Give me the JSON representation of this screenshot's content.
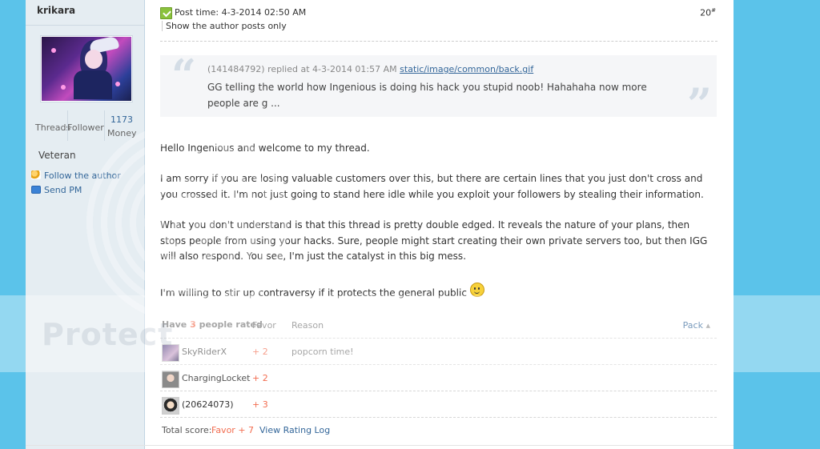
{
  "author": {
    "name": "krikara",
    "stats": [
      {
        "label": "Threads",
        "value": ""
      },
      {
        "label": "Follower",
        "value": ""
      },
      {
        "label": "Money",
        "value": "1173"
      }
    ],
    "rank": "Veteran",
    "follow_label": "Follow the author",
    "pm_label": "Send PM"
  },
  "post": {
    "time": "Post time: 4-3-2014 02:50 AM",
    "floor": "20",
    "floor_suffix": "#",
    "author_only": "Show the author posts only",
    "quote": {
      "meta": "(141484792) replied at 4-3-2014 01:57 AM",
      "link": "static/image/common/back.gif",
      "text": "GG telling the world how Ingenious is doing his hack you stupid noob! Hahahaha now more people are g ..."
    },
    "paragraphs": [
      "Hello Ingenious and welcome to my thread.",
      "I am sorry if you are losing valuable customers over this, but there are certain lines that you just don't cross and you crossed it. I'm not just going to stand here idle while you exploit your followers by stealing their information.",
      "What you don't understand is that this thread is pretty double edged. It reveals the nature of your plans, then stops people from using your hacks. Sure, people might start creating their own private servers too, but then IGG will also respond. You see, I'm just the catalyst in this big mess.",
      "I'm willing to stir up contraversy if it protects the general public"
    ]
  },
  "rating": {
    "have_prefix": "Have",
    "count": "3",
    "have_suffix": "people rated",
    "favor_header": "Favor",
    "reason_header": "Reason",
    "pack_label": "Pack",
    "pack_arrow": "▴",
    "rows": [
      {
        "name": "SkyRiderX",
        "score": "+ 2",
        "reason": "popcorn time!"
      },
      {
        "name": "ChargingLocket",
        "score": "+ 2",
        "reason": ""
      },
      {
        "name": "(20624073)",
        "score": "+ 3",
        "reason": ""
      }
    ],
    "total_label": "Total score:",
    "total_favor": "Favor + 7",
    "log_label": "View Rating Log"
  },
  "watermark": "Protect",
  "colors": {
    "background": "#5bc3ea",
    "link": "#336699",
    "score": "#f26c4f",
    "author_panel": "#e5edf2"
  }
}
